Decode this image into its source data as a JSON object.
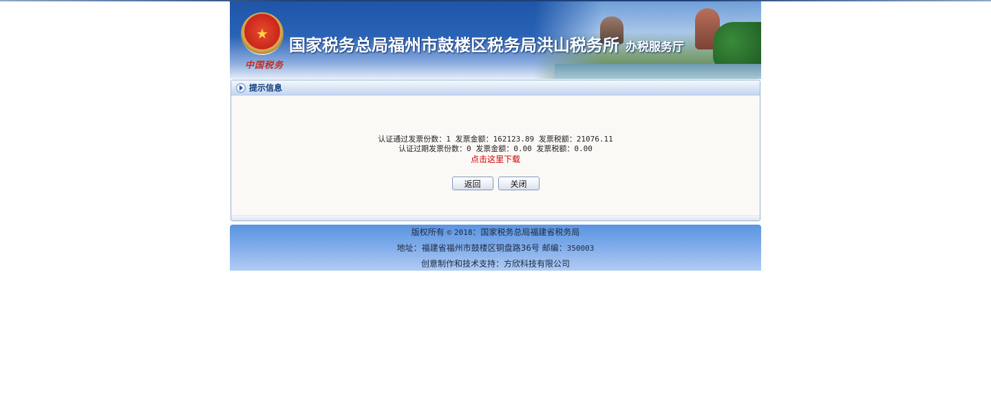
{
  "header": {
    "emblem_caption": "中国税务",
    "title": "国家税务总局福州市鼓楼区税务局洪山税务所",
    "subtitle": "办税服务厅"
  },
  "panel": {
    "title": "提示信息",
    "line1": "认证通过发票份数：1 发票金额：162123.89 发票税额：21076.11",
    "line2": "认证过期发票份数：0 发票金额：0.00 发票税额：0.00",
    "download_link": "点击这里下载",
    "back_button": "返回",
    "close_button": "关闭"
  },
  "footer": {
    "copyright_prefix": "版权所有",
    "copyright_symbol": "©",
    "copyright_year": "2018",
    "copyright_owner": "：国家税务总局福建省税务局",
    "address_prefix": "地址：福建省福州市鼓楼区铜盘路36号 邮编：",
    "postcode": "350003",
    "support": "创意制作和技术支持：方欣科技有限公司"
  },
  "icons": {
    "panel_header": "arrow-circle-icon",
    "emblem": "tax-emblem-icon"
  },
  "colors": {
    "banner_blue": "#1e55a8",
    "link_red": "#cc0000",
    "panel_title": "#103c7e",
    "footer_blue": "#5a94e0"
  }
}
